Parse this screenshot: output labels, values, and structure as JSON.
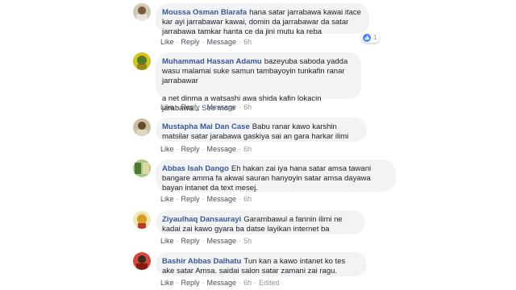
{
  "comments": [
    {
      "author": "Moussa Osman Blarafa",
      "text": "hana satar jarrabawa kawai itace kar ayi jarrabawar kawai, domin da jarrabawar da satar jarrabawa tamkar hanta ce da jini mutu ka reba",
      "actions": {
        "like": "Like",
        "reply": "Reply",
        "message": "Message",
        "time": "6h"
      },
      "reaction_count": "1",
      "avatar_color": "#c9c4b0"
    },
    {
      "author": "Muhammad Hassan Adamu",
      "text": "bazeyuba saboda yadda wasu malamai suke samun tambayoyin tunkafin ranar jarrabawar",
      "text2": "a net dinma a watsashi awa shida kafin lokacin jarabawa...",
      "see_more": "See more",
      "actions": {
        "like": "Like",
        "reply": "Reply",
        "message": "Message",
        "time": "6h"
      },
      "avatar_color": "#c8b820"
    },
    {
      "author": "Mustapha Mai Dan Case",
      "text": "Babu ranar kawo karshin matsilar satar jarabawa gaskiya sai an gara harkar ilimi",
      "actions": {
        "like": "Like",
        "reply": "Reply",
        "message": "Message",
        "time": "6h"
      },
      "avatar_color": "#b7b08a"
    },
    {
      "author": "Abbas Isah Dango",
      "text": "Eh hakan zai iya hana satar amsa tawani bangare amma fa akwai sauran hanyoyin satar amsa dayawa bayan intanet da text mesej.",
      "actions": {
        "like": "Like",
        "reply": "Reply",
        "message": "Message",
        "time": "6h"
      },
      "avatar_color": "#8fb56a"
    },
    {
      "author": "Ziyaulhaq Dansaurayi",
      "text": "Garambawul a fannin ilimi ne kadai zai kawo gyara ba datse layikan internet ba",
      "actions": {
        "like": "Like",
        "reply": "Reply",
        "message": "Message",
        "time": "5h"
      },
      "avatar_color": "#d9c04a"
    },
    {
      "author": "Bashir Abbas Dalhatu",
      "text": "Tun kan a kawo intanet ko tes ake satar Amsa. saidai salon satar zamani zai ragu.",
      "actions": {
        "like": "Like",
        "reply": "Reply",
        "message": "Message",
        "time": "6h",
        "edited": "Edited"
      },
      "avatar_color": "#c0392b"
    }
  ]
}
